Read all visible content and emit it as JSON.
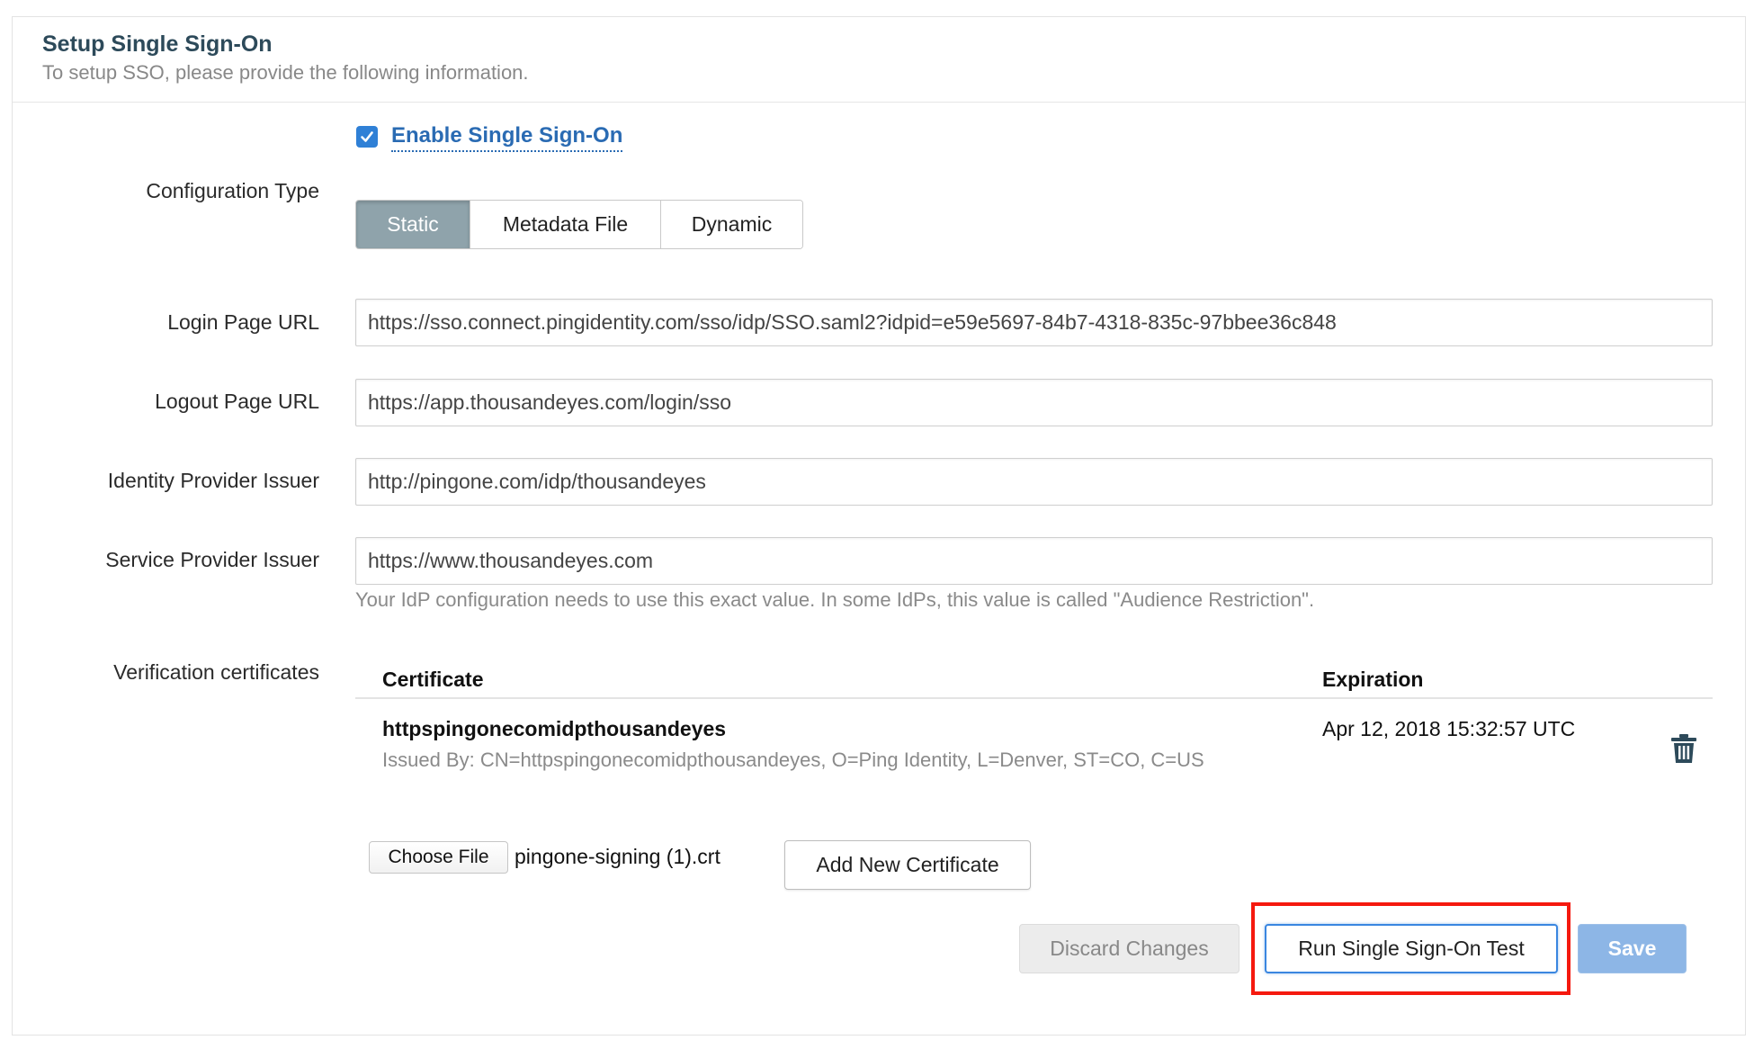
{
  "header": {
    "title": "Setup Single Sign-On",
    "subtitle": "To setup SSO, please provide the following information."
  },
  "enable_sso": {
    "label": "Enable Single Sign-On",
    "checked": true
  },
  "config_type": {
    "label": "Configuration Type",
    "options": [
      "Static",
      "Metadata File",
      "Dynamic"
    ],
    "selected": "Static"
  },
  "login_url": {
    "label": "Login Page URL",
    "value": "https://sso.connect.pingidentity.com/sso/idp/SSO.saml2?idpid=e59e5697-84b7-4318-835c-97bbee36c848"
  },
  "logout_url": {
    "label": "Logout Page URL",
    "value": "https://app.thousandeyes.com/login/sso"
  },
  "idp_issuer": {
    "label": "Identity Provider Issuer",
    "value": "http://pingone.com/idp/thousandeyes"
  },
  "sp_issuer": {
    "label": "Service Provider Issuer",
    "value": "https://www.thousandeyes.com",
    "help": "Your IdP configuration needs to use this exact value. In some IdPs, this value is called \"Audience Restriction\"."
  },
  "certificates": {
    "label": "Verification certificates",
    "columns": {
      "certificate": "Certificate",
      "expiration": "Expiration"
    },
    "rows": [
      {
        "name": "httpspingonecomidpthousandeyes",
        "issuer": "Issued By: CN=httpspingonecomidpthousandeyes, O=Ping Identity, L=Denver, ST=CO, C=US",
        "expiration": "Apr 12, 2018 15:32:57 UTC"
      }
    ],
    "choose_file_label": "Choose File",
    "file_name": "pingone-signing (1).crt",
    "add_button": "Add New Certificate"
  },
  "actions": {
    "discard": "Discard Changes",
    "test": "Run Single Sign-On Test",
    "save": "Save"
  },
  "colors": {
    "accent": "#2f80d6",
    "highlight": "#f5190f",
    "save": "#8db6e6",
    "title": "#2d4a5a"
  },
  "icons": {
    "checkbox": "checkmark-icon",
    "delete": "trash-icon"
  }
}
